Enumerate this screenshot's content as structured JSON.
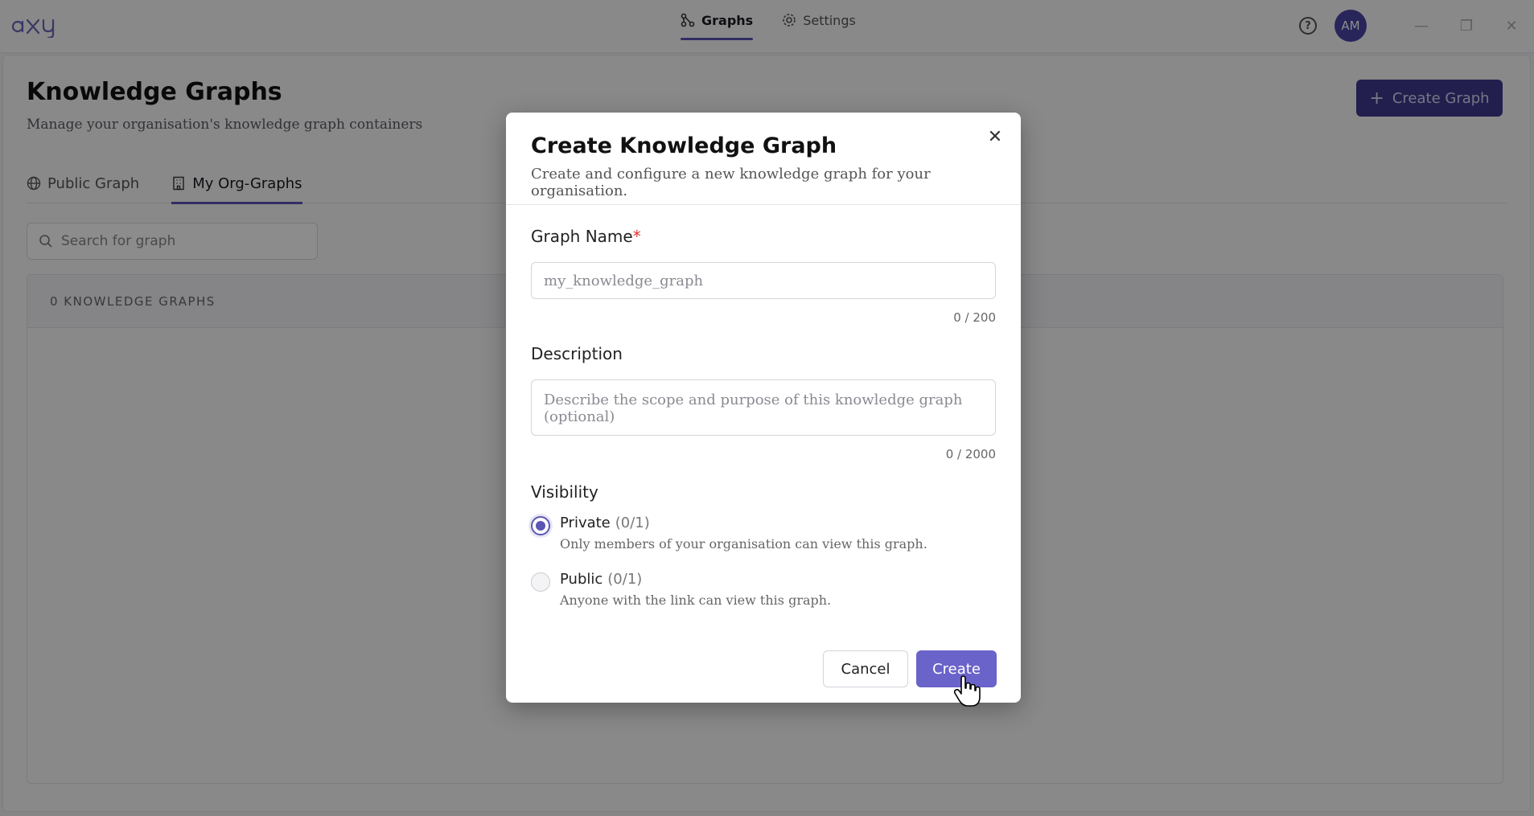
{
  "app": {
    "logo_text": "axy"
  },
  "nav": {
    "tabs": [
      {
        "label": "Graphs",
        "icon": "graph-icon",
        "active": true
      },
      {
        "label": "Settings",
        "icon": "gear-icon",
        "active": false
      }
    ]
  },
  "user": {
    "initials": "AM"
  },
  "page": {
    "title": "Knowledge Graphs",
    "subtitle": "Manage your organisation's knowledge graph containers",
    "create_button": "Create Graph",
    "tabs": [
      {
        "label": "Public Graph",
        "icon": "globe-icon",
        "active": false
      },
      {
        "label": "My Org-Graphs",
        "icon": "building-icon",
        "active": true
      }
    ],
    "search_placeholder": "Search for graph",
    "list_header": "0 KNOWLEDGE GRAPHS"
  },
  "modal": {
    "title": "Create Knowledge Graph",
    "subtitle": "Create and configure a new knowledge graph for your organisation.",
    "name_label": "Graph Name",
    "name_required": "*",
    "name_placeholder": "my_knowledge_graph",
    "name_counter": "0 / 200",
    "description_label": "Description",
    "description_placeholder": "Describe the scope and purpose of this knowledge graph (optional)",
    "description_counter": "0 / 2000",
    "visibility_label": "Visibility",
    "options": [
      {
        "title": "Private",
        "count": "(0/1)",
        "desc": "Only members of your organisation can view this graph.",
        "checked": true
      },
      {
        "title": "Public",
        "count": "(0/1)",
        "desc": "Anyone with the link can view this graph.",
        "checked": false
      }
    ],
    "cancel_label": "Cancel",
    "create_label": "Create"
  },
  "colors": {
    "accent": "#5b55b5",
    "primary_button": "#6a63c9",
    "required": "#dd3333"
  }
}
